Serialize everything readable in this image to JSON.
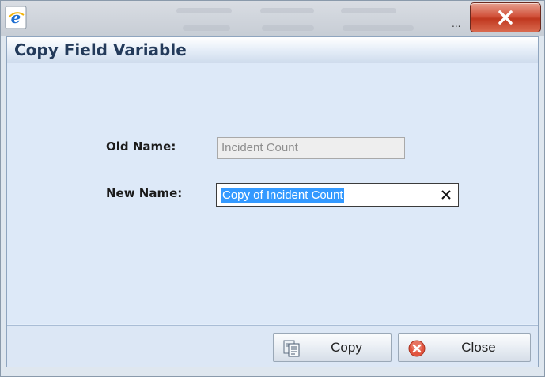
{
  "window": {
    "dots": "...",
    "close_icon": "close-icon"
  },
  "dialog": {
    "title": "Copy Field Variable",
    "old_name": {
      "label": "Old Name:",
      "value": "Incident Count"
    },
    "new_name": {
      "label": "New Name:",
      "value": "Copy of Incident Count",
      "selected": true
    },
    "buttons": {
      "copy": "Copy",
      "close": "Close"
    }
  },
  "colors": {
    "close_button": "#c0381f",
    "selection": "#3399ff",
    "title_text": "#233a5a"
  }
}
